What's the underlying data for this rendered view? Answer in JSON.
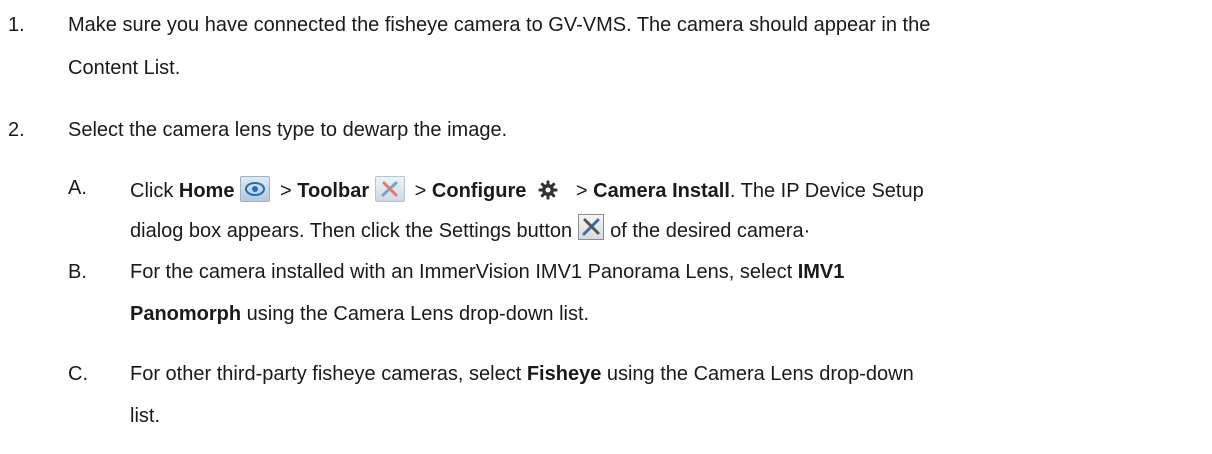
{
  "step1": {
    "number": "1.",
    "line1": "Make sure you have connected the fisheye camera to GV-VMS. The camera should appear in the",
    "line2": "Content List."
  },
  "step2": {
    "number": "2.",
    "text": "Select the camera lens type to dewarp the image."
  },
  "substep_a": {
    "letter": "A.",
    "click": "Click ",
    "home": "Home",
    "sep1": " > ",
    "toolbar": "Toolbar",
    "sep2": " > ",
    "configure": "Configure",
    "sep3": " > ",
    "camera_install": "Camera Install",
    "tail": ". The IP Device Setup",
    "line2_start": "dialog box appears. Then click the Settings button",
    "line2_end": "of the desired camera·"
  },
  "substep_b": {
    "letter": "B.",
    "line1_start": "For the camera installed with an ImmerVision IMV1 Panorama Lens, select ",
    "line1_bold": "IMV1",
    "line2_bold": "Panomorph",
    "line2_end": " using the Camera Lens drop-down list."
  },
  "substep_c": {
    "letter": "C.",
    "line1_start": "For other third-party fisheye cameras, select ",
    "line1_bold": "Fisheye",
    "line1_end": " using the Camera Lens drop-down",
    "line2": "list."
  },
  "icons": {
    "home": "eye-icon",
    "toolbar": "tools-icon",
    "configure": "gear-icon",
    "settings": "settings-icon"
  }
}
